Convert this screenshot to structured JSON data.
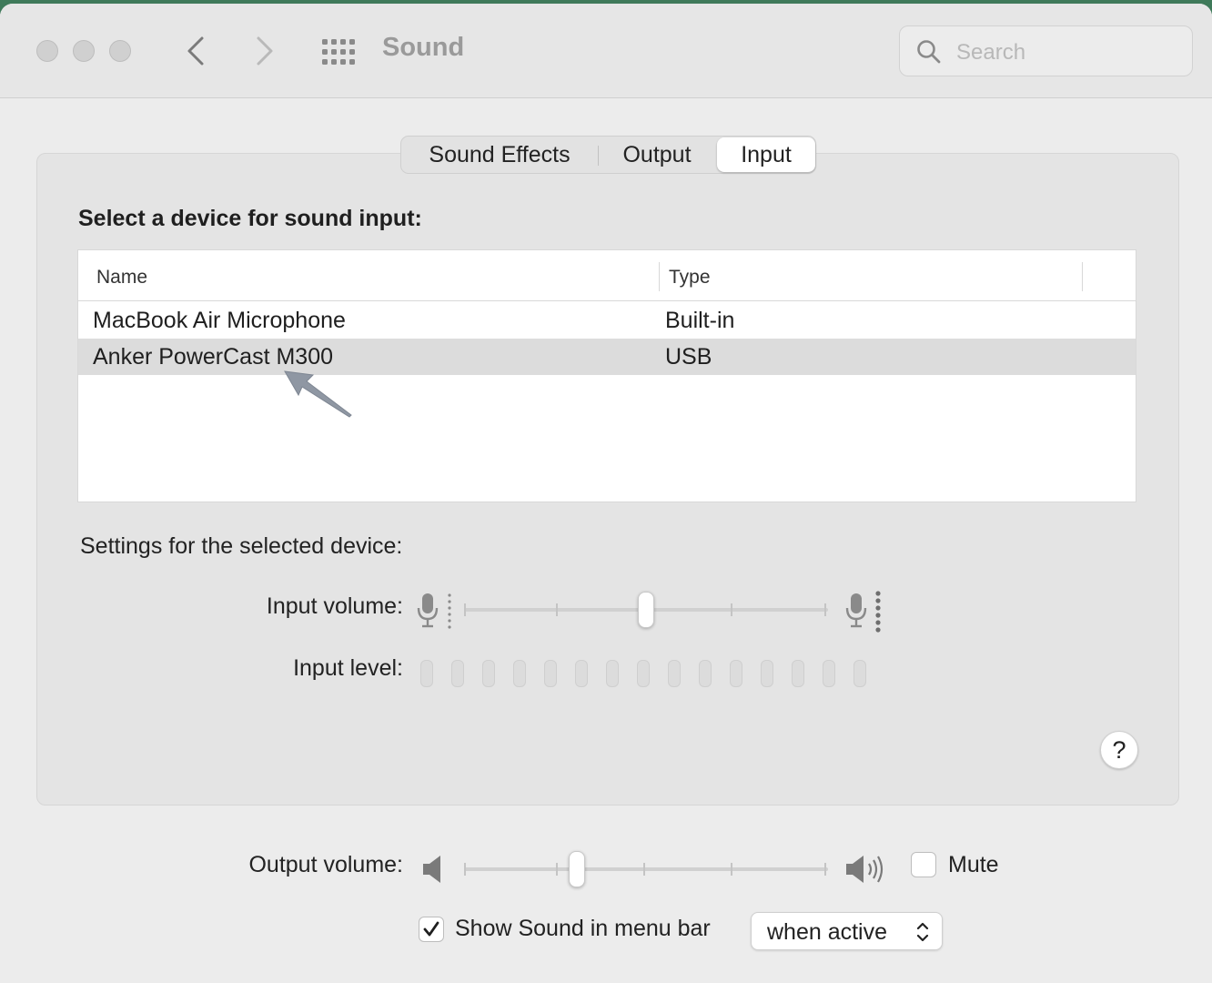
{
  "window": {
    "title": "Sound",
    "search_placeholder": "Search"
  },
  "tabs": [
    {
      "label": "Sound Effects",
      "active": false
    },
    {
      "label": "Output",
      "active": false
    },
    {
      "label": "Input",
      "active": true
    }
  ],
  "input": {
    "heading": "Select a device for sound input:",
    "columns": [
      "Name",
      "Type"
    ],
    "devices": [
      {
        "name": "MacBook Air Microphone",
        "type": "Built-in",
        "selected": false
      },
      {
        "name": "Anker PowerCast M300",
        "type": "USB",
        "selected": true
      }
    ],
    "settings_heading": "Settings for the selected device:",
    "volume_label": "Input volume:",
    "volume_value": 0.5,
    "level_label": "Input level:",
    "level_bars_total": 15,
    "level_bars_lit": 0
  },
  "output": {
    "volume_label": "Output volume:",
    "volume_value": 0.31,
    "mute_label": "Mute",
    "mute_checked": false
  },
  "menubar": {
    "show_label": "Show Sound in menu bar",
    "show_checked": true,
    "when_value": "when active"
  },
  "icons": [
    "back-chevron-icon",
    "forward-chevron-icon",
    "grid-icon",
    "search-icon",
    "mic-low-icon",
    "mic-high-icon",
    "speaker-low-icon",
    "speaker-high-icon",
    "checkmark-icon",
    "up-down-chevron-icon",
    "help-icon",
    "pointer-arrow-icon"
  ]
}
